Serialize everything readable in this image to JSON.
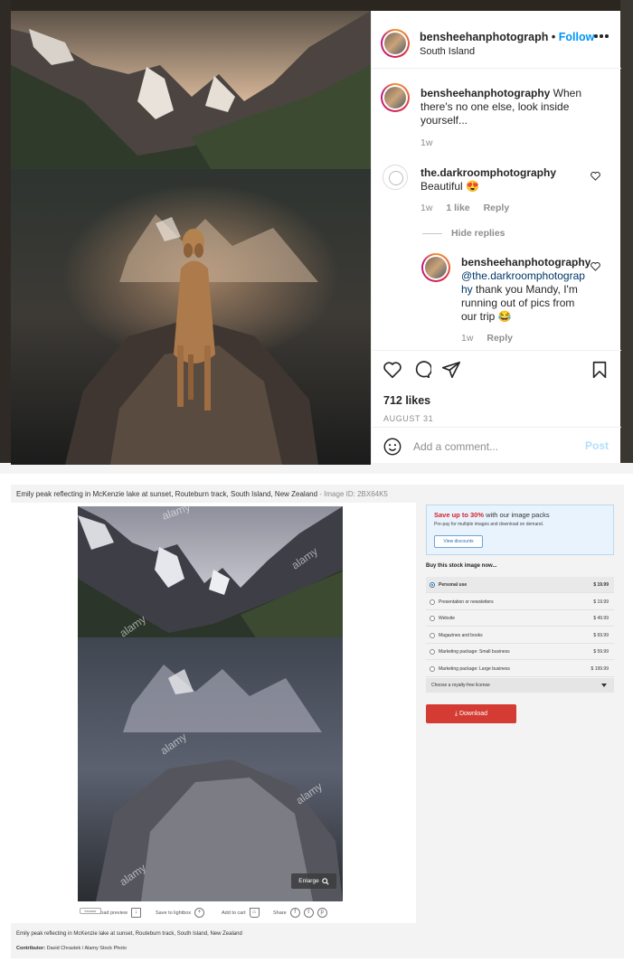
{
  "instagram": {
    "header": {
      "username": "bensheehanphotograph",
      "separator": "•",
      "follow": "Follow",
      "location": "South Island",
      "more_icon": "more-horizontal-icon"
    },
    "caption": {
      "username": "bensheehanphotography",
      "text": " When there's no one else, look inside yourself...",
      "time": "1w"
    },
    "comment": {
      "username": "the.darkroomphotography",
      "text": "Beautiful 😍",
      "time": "1w",
      "likes": "1 like",
      "reply": "Reply",
      "hide_replies": "Hide replies"
    },
    "reply": {
      "username": "bensheehanphotography",
      "mention": "@the.darkroomphotography",
      "text": " thank you Mandy, I'm running out of pics from our trip 😂",
      "time": "1w",
      "reply": "Reply"
    },
    "actions": {
      "like_icon": "heart-icon",
      "comment_icon": "comment-icon",
      "share_icon": "paper-plane-icon",
      "save_icon": "bookmark-icon"
    },
    "likes": "712 likes",
    "date": "AUGUST 31",
    "add_comment": {
      "emoji_icon": "smiley-icon",
      "placeholder": "Add a comment...",
      "post": "Post"
    }
  },
  "stock": {
    "title": "Emily peak reflecting in McKenzie lake at sunset, Routeburn track, South Island, New Zealand",
    "image_id": " - Image ID: 2BX64K5",
    "watermark": "alamy",
    "enlarge": "Enlarge",
    "tools": {
      "download_preview": "Download preview",
      "save_lightbox": "Save to lightbox",
      "add_cart": "Add to cart",
      "share": "Share",
      "chip": "browse"
    },
    "caption": "Emily peak reflecting in McKenzie lake at sunset, Routeburn track, South Island, New Zealand",
    "contributor_label": "Contributor:",
    "contributor": " David Chrastek / Alamy Stock Photo",
    "offer": {
      "highlight": "Save up to 30%",
      "rest": " with our image packs",
      "sub": "Pre-pay for multiple images and download on demand.",
      "button": "View discounts"
    },
    "buy_heading": "Buy this stock image now...",
    "prices": [
      {
        "label": "Personal use",
        "price": "$ 19.99",
        "selected": true
      },
      {
        "label": "Presentation or newsletters",
        "price": "$ 19.99",
        "selected": false
      },
      {
        "label": "Website",
        "price": "$ 49.99",
        "selected": false
      },
      {
        "label": "Magazines and books",
        "price": "$ 69.99",
        "selected": false
      },
      {
        "label": "Marketing package: Small business",
        "price": "$ 59.99",
        "selected": false
      },
      {
        "label": "Marketing package: Large business",
        "price": "$ 199.99",
        "selected": false
      }
    ],
    "license": "Choose a royalty-free license",
    "download": "⤓ Download"
  },
  "colors": {
    "instagram_blue": "#0095f6",
    "alamy_red": "#d43b32",
    "offer_red": "#d5232a"
  }
}
